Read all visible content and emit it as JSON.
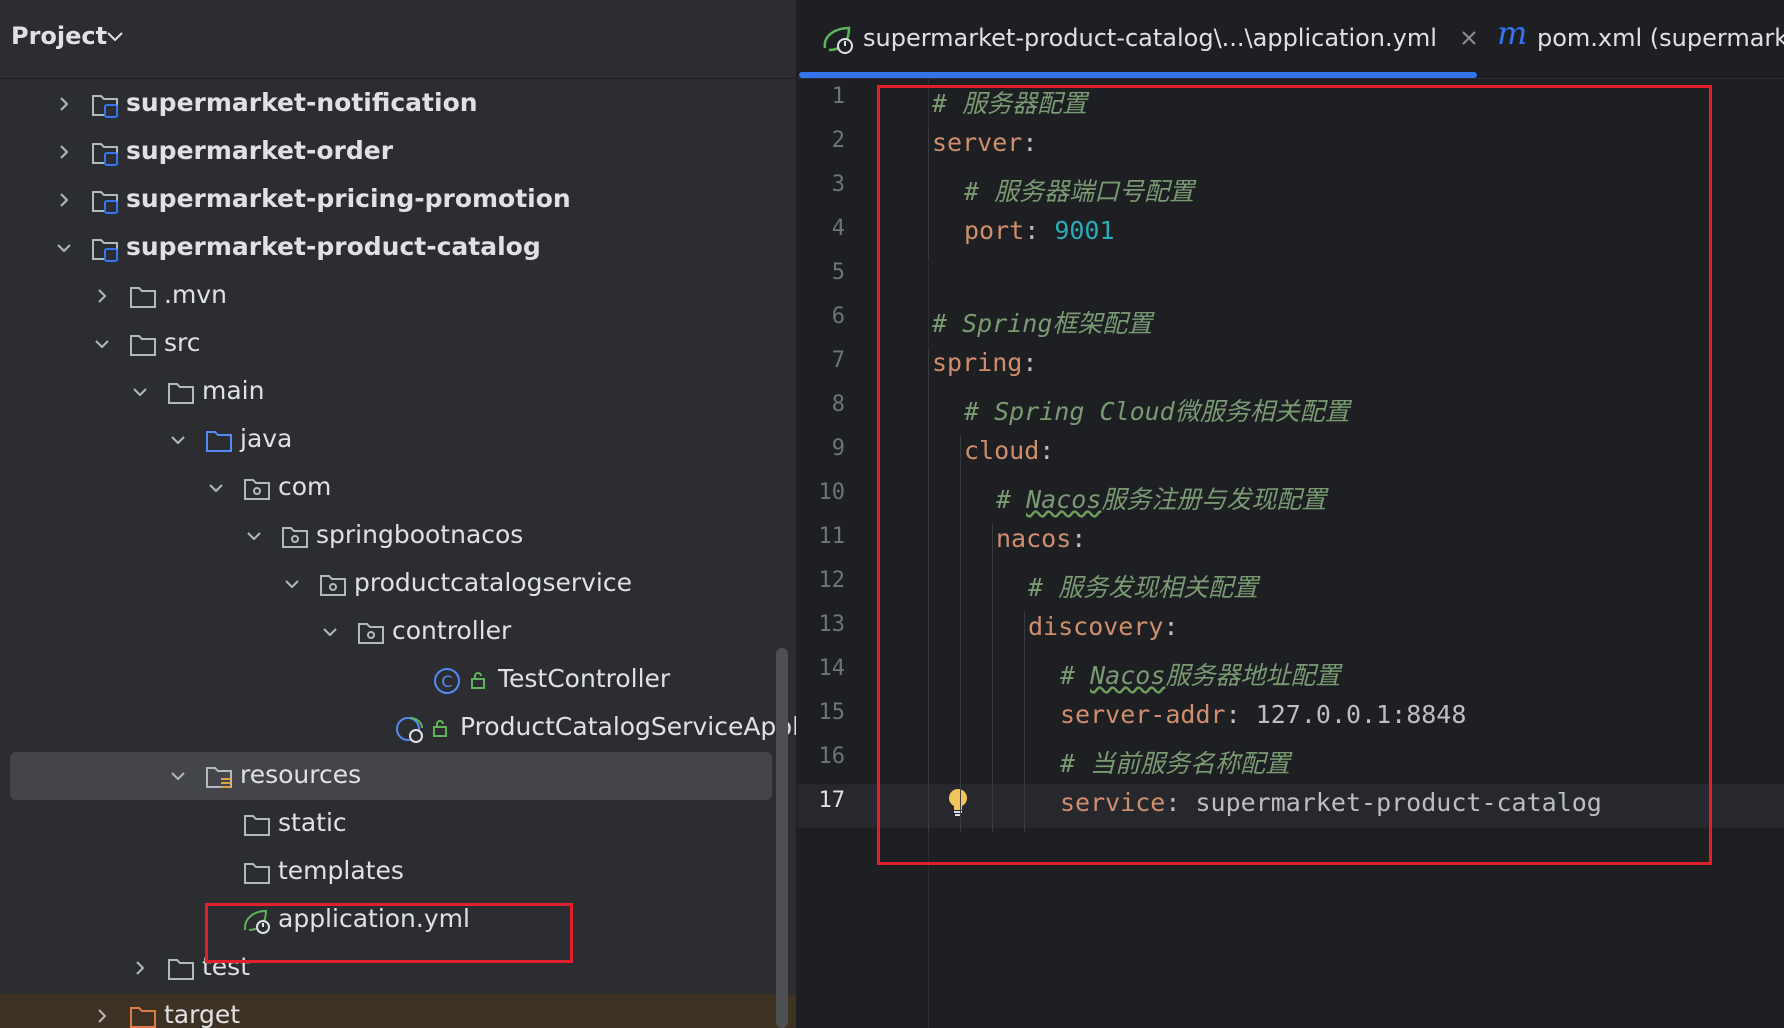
{
  "project_pane": {
    "title": "Project",
    "tree": [
      {
        "label": "supermarket-notification",
        "bold": true,
        "expanded": false,
        "type": "module"
      },
      {
        "label": "supermarket-order",
        "bold": true,
        "expanded": false,
        "type": "module"
      },
      {
        "label": "supermarket-pricing-promotion",
        "bold": true,
        "expanded": false,
        "type": "module"
      },
      {
        "label": "supermarket-product-catalog",
        "bold": true,
        "expanded": true,
        "type": "module"
      },
      {
        "label": ".mvn",
        "expanded": false,
        "type": "folder"
      },
      {
        "label": "src",
        "expanded": true,
        "type": "folder"
      },
      {
        "label": "main",
        "expanded": true,
        "type": "folder"
      },
      {
        "label": "java",
        "expanded": true,
        "type": "source-folder"
      },
      {
        "label": "com",
        "expanded": true,
        "type": "package"
      },
      {
        "label": "springbootnacos",
        "expanded": true,
        "type": "package"
      },
      {
        "label": "productcatalogservice",
        "expanded": true,
        "type": "package"
      },
      {
        "label": "controller",
        "expanded": true,
        "type": "package"
      },
      {
        "label": "TestController",
        "type": "class"
      },
      {
        "label": "ProductCatalogServiceApplicatio",
        "type": "spring-class"
      },
      {
        "label": "resources",
        "expanded": true,
        "type": "resources-folder",
        "selected": true
      },
      {
        "label": "static",
        "type": "folder"
      },
      {
        "label": "templates",
        "type": "folder"
      },
      {
        "label": "application.yml",
        "type": "yml-file"
      },
      {
        "label": "test",
        "expanded": false,
        "type": "folder"
      },
      {
        "label": "target",
        "expanded": false,
        "type": "excluded-folder"
      }
    ]
  },
  "editor": {
    "tabs": [
      {
        "label": "supermarket-product-catalog\\...\\application.yml",
        "active": true,
        "icon": "spring-yml-icon"
      },
      {
        "label": "pom.xml (supermarke",
        "active": false,
        "icon": "maven-icon"
      }
    ],
    "current_line": 17,
    "line_numbers": [
      "1",
      "2",
      "3",
      "4",
      "5",
      "6",
      "7",
      "8",
      "9",
      "10",
      "11",
      "12",
      "13",
      "14",
      "15",
      "16",
      "17"
    ],
    "lines": [
      {
        "comment": "# 服务器配置"
      },
      {
        "key": "server",
        "punct": ":"
      },
      {
        "comment": "# 服务器端口号配置"
      },
      {
        "key": "port",
        "punct": ": ",
        "num": "9001"
      },
      {},
      {
        "comment": "# Spring框架配置"
      },
      {
        "key": "spring",
        "punct": ":"
      },
      {
        "comment": "# Spring Cloud微服务相关配置"
      },
      {
        "key": "cloud",
        "punct": ":"
      },
      {
        "comment_pre": "# ",
        "comment_wavy": "Nacos",
        "comment_post": "服务注册与发现配置"
      },
      {
        "key": "nacos",
        "punct": ":"
      },
      {
        "comment": "# 服务发现相关配置"
      },
      {
        "key": "discovery",
        "punct": ":"
      },
      {
        "comment_pre": "# ",
        "comment_wavy": "Nacos",
        "comment_post": "服务器地址配置"
      },
      {
        "key": "server-addr",
        "punct": ": ",
        "val": "127.0.0.1:8848"
      },
      {
        "comment": "# 当前服务名称配置"
      },
      {
        "key": "service",
        "punct": ": ",
        "val": "supermarket-product-catalog"
      }
    ]
  },
  "colors": {
    "highlight_box": "#e0202a",
    "accent": "#3574f0",
    "yaml_key": "#cf8e6d",
    "yaml_number": "#2aacb8",
    "comment": "#7a9a74"
  }
}
